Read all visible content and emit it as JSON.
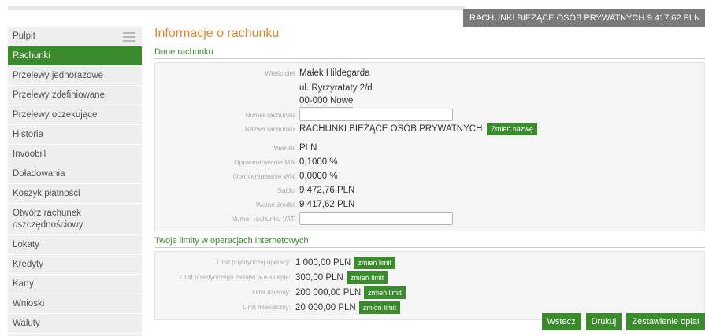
{
  "header": {
    "account_name": "RACHUNKI BIEŻĄCE OSÓB PRYWATNYCH",
    "account_amount": "9 417,62 PLN"
  },
  "sidebar": {
    "items": [
      {
        "label": "Pulpit"
      },
      {
        "label": "Rachunki"
      },
      {
        "label": "Przelewy jednorazowe"
      },
      {
        "label": "Przelewy zdefiniowane"
      },
      {
        "label": "Przelewy oczekujące"
      },
      {
        "label": "Historia"
      },
      {
        "label": "Invoobill"
      },
      {
        "label": "Doładowania"
      },
      {
        "label": "Koszyk płatności"
      },
      {
        "label": "Otwórz rachunek oszczędnościowy"
      },
      {
        "label": "Lokaty"
      },
      {
        "label": "Kredyty"
      },
      {
        "label": "Karty"
      },
      {
        "label": "Wnioski"
      },
      {
        "label": "Waluty"
      }
    ]
  },
  "main": {
    "title": "Informacje o rachunku",
    "account_section": "Dane rachunku",
    "owner_label": "Właściciel",
    "owner": "Małek Hildegarda",
    "address_line1": "ul. Ryrzyratаty 2/d",
    "address_line2": "00-000 Nowe",
    "account_number_label": "Numer rachunku",
    "account_number_value": "",
    "account_name_label": "Nazwa rachunku",
    "account_name_value": "RACHUNKI BIEŻĄCE OSÓB PRYWATNYCH",
    "change_name_btn": "Zmień nazwę",
    "currency_label": "Waluta",
    "currency_value": "PLN",
    "interest_ma_label": "Oprocentowanie MA",
    "interest_ma_value": "0,1000 %",
    "interest_wn_label": "Oprocentowanie WN",
    "interest_wn_value": "0,0000 %",
    "balance_label": "Saldo",
    "balance_value": "9 472,76 PLN",
    "available_label": "Wolne środki",
    "available_value": "9 417,62 PLN",
    "vat_label": "Numer rachunku VAT",
    "vat_value": ""
  },
  "limits": {
    "section": "Twoje limity w operacjach internetowych",
    "items": [
      {
        "label": "Limit pojedynczej operacji:",
        "value": "1 000,00 PLN",
        "btn": "zmień limit"
      },
      {
        "label": "Limit pojedynczego zakupu w e-sklepie:",
        "value": "300,00 PLN",
        "btn": "zmień limit"
      },
      {
        "label": "Limit dzienny:",
        "value": "200 000,00 PLN",
        "btn": "zmień limit"
      },
      {
        "label": "Limit miesięczny:",
        "value": "20 000,00 PLN",
        "btn": "zmień limit"
      }
    ]
  },
  "footer": {
    "back": "Wstecz",
    "print": "Drukuj",
    "fees": "Zestawienie opłat"
  },
  "colors": {
    "accent_green": "#3c8a2e",
    "title_orange": "#e2872f",
    "header_gray": "#7a7a7a"
  }
}
